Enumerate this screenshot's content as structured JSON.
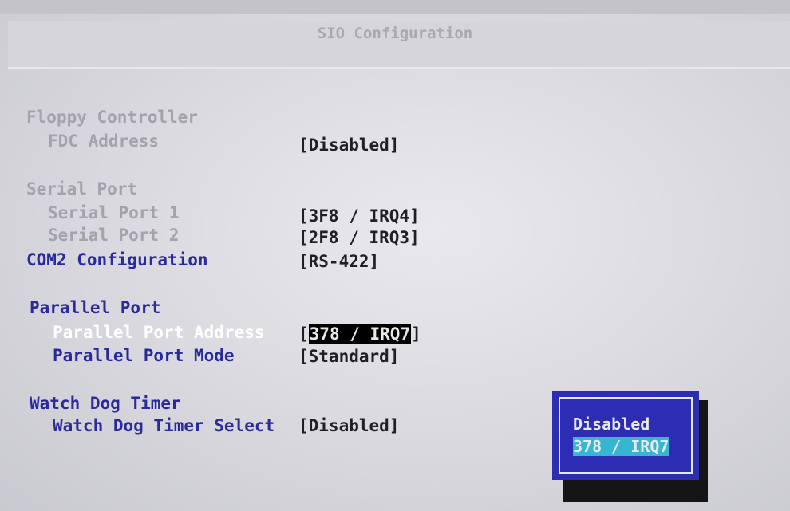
{
  "header": {
    "title": "SIO Configuration"
  },
  "sections": {
    "floppy": {
      "heading": "Floppy Controller",
      "fdc_label": "FDC Address",
      "fdc_value": "[Disabled]"
    },
    "serial": {
      "heading": "Serial Port",
      "port1_label": "Serial Port 1",
      "port1_value": "[3F8 / IRQ4]",
      "port2_label": "Serial Port 2",
      "port2_value": "[2F8 / IRQ3]",
      "com2_label": "COM2 Configuration",
      "com2_value": "[RS-422]"
    },
    "parallel": {
      "heading": "Parallel Port",
      "address_label": "Parallel Port Address",
      "address_value_open": "[",
      "address_value": "378 / IRQ7",
      "address_value_close": "]",
      "mode_label": "Parallel Port Mode",
      "mode_value": "[Standard]"
    },
    "watchdog": {
      "heading": "Watch Dog Timer",
      "select_label": "Watch Dog Timer Select",
      "select_value": "[Disabled]"
    }
  },
  "popup": {
    "options": [
      "Disabled",
      "378 / IRQ7"
    ],
    "selected": "378 / IRQ7"
  },
  "colors": {
    "screen_background": "#dcdce0",
    "inactive_text": "#a3a3ab",
    "active_label": "#2a2a9a",
    "focused_label": "#ffffff",
    "popup_background": "#2d2db3",
    "popup_highlight": "#37b6cf"
  }
}
